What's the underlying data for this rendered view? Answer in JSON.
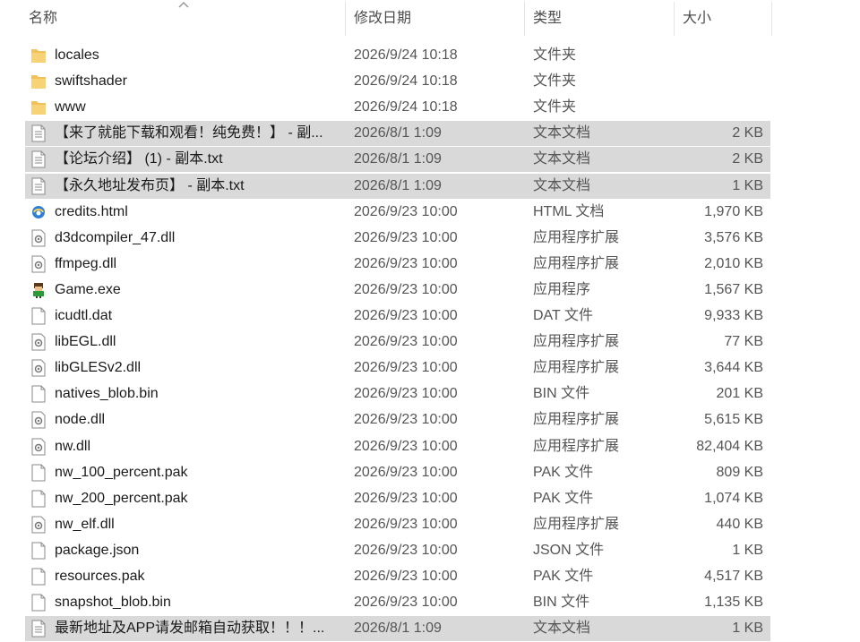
{
  "columns": {
    "name": "名称",
    "date": "修改日期",
    "type": "类型",
    "size": "大小"
  },
  "files": [
    {
      "name": "locales",
      "date": "2026/9/24 10:18",
      "type": "文件夹",
      "size": "",
      "icon": "folder-icon",
      "selected": false
    },
    {
      "name": "swiftshader",
      "date": "2026/9/24 10:18",
      "type": "文件夹",
      "size": "",
      "icon": "folder-icon",
      "selected": false
    },
    {
      "name": "www",
      "date": "2026/9/24 10:18",
      "type": "文件夹",
      "size": "",
      "icon": "folder-icon",
      "selected": false
    },
    {
      "name": "【来了就能下载和观看！纯免费！】 - 副...",
      "date": "2026/8/1 1:09",
      "type": "文本文档",
      "size": "2 KB",
      "icon": "text-file-icon",
      "selected": true
    },
    {
      "name": "【论坛介绍】 (1) - 副本.txt",
      "date": "2026/8/1 1:09",
      "type": "文本文档",
      "size": "2 KB",
      "icon": "text-file-icon",
      "selected": true
    },
    {
      "name": "【永久地址发布页】 - 副本.txt",
      "date": "2026/8/1 1:09",
      "type": "文本文档",
      "size": "1 KB",
      "icon": "text-file-icon",
      "selected": true
    },
    {
      "name": "credits.html",
      "date": "2026/9/23 10:00",
      "type": "HTML 文档",
      "size": "1,970 KB",
      "icon": "html-file-icon",
      "selected": false
    },
    {
      "name": "d3dcompiler_47.dll",
      "date": "2026/9/23 10:00",
      "type": "应用程序扩展",
      "size": "3,576 KB",
      "icon": "dll-file-icon",
      "selected": false
    },
    {
      "name": "ffmpeg.dll",
      "date": "2026/9/23 10:00",
      "type": "应用程序扩展",
      "size": "2,010 KB",
      "icon": "dll-file-icon",
      "selected": false
    },
    {
      "name": "Game.exe",
      "date": "2026/9/23 10:00",
      "type": "应用程序",
      "size": "1,567 KB",
      "icon": "game-exe-icon",
      "selected": false
    },
    {
      "name": "icudtl.dat",
      "date": "2026/9/23 10:00",
      "type": "DAT 文件",
      "size": "9,933 KB",
      "icon": "blank-file-icon",
      "selected": false
    },
    {
      "name": "libEGL.dll",
      "date": "2026/9/23 10:00",
      "type": "应用程序扩展",
      "size": "77 KB",
      "icon": "dll-file-icon",
      "selected": false
    },
    {
      "name": "libGLESv2.dll",
      "date": "2026/9/23 10:00",
      "type": "应用程序扩展",
      "size": "3,644 KB",
      "icon": "dll-file-icon",
      "selected": false
    },
    {
      "name": "natives_blob.bin",
      "date": "2026/9/23 10:00",
      "type": "BIN 文件",
      "size": "201 KB",
      "icon": "blank-file-icon",
      "selected": false
    },
    {
      "name": "node.dll",
      "date": "2026/9/23 10:00",
      "type": "应用程序扩展",
      "size": "5,615 KB",
      "icon": "dll-file-icon",
      "selected": false
    },
    {
      "name": "nw.dll",
      "date": "2026/9/23 10:00",
      "type": "应用程序扩展",
      "size": "82,404 KB",
      "icon": "dll-file-icon",
      "selected": false
    },
    {
      "name": "nw_100_percent.pak",
      "date": "2026/9/23 10:00",
      "type": "PAK 文件",
      "size": "809 KB",
      "icon": "blank-file-icon",
      "selected": false
    },
    {
      "name": "nw_200_percent.pak",
      "date": "2026/9/23 10:00",
      "type": "PAK 文件",
      "size": "1,074 KB",
      "icon": "blank-file-icon",
      "selected": false
    },
    {
      "name": "nw_elf.dll",
      "date": "2026/9/23 10:00",
      "type": "应用程序扩展",
      "size": "440 KB",
      "icon": "dll-file-icon",
      "selected": false
    },
    {
      "name": "package.json",
      "date": "2026/9/23 10:00",
      "type": "JSON 文件",
      "size": "1 KB",
      "icon": "blank-file-icon",
      "selected": false
    },
    {
      "name": "resources.pak",
      "date": "2026/9/23 10:00",
      "type": "PAK 文件",
      "size": "4,517 KB",
      "icon": "blank-file-icon",
      "selected": false
    },
    {
      "name": "snapshot_blob.bin",
      "date": "2026/9/23 10:00",
      "type": "BIN 文件",
      "size": "1,135 KB",
      "icon": "blank-file-icon",
      "selected": false
    },
    {
      "name": "最新地址及APP请发邮箱自动获取！！！...",
      "date": "2026/8/1 1:09",
      "type": "文本文档",
      "size": "1 KB",
      "icon": "text-file-icon",
      "selected": true
    }
  ],
  "colors": {
    "selected_row": "#d9d9d9",
    "folder": "#f2c15a",
    "header_text": "#4d4d4d"
  }
}
